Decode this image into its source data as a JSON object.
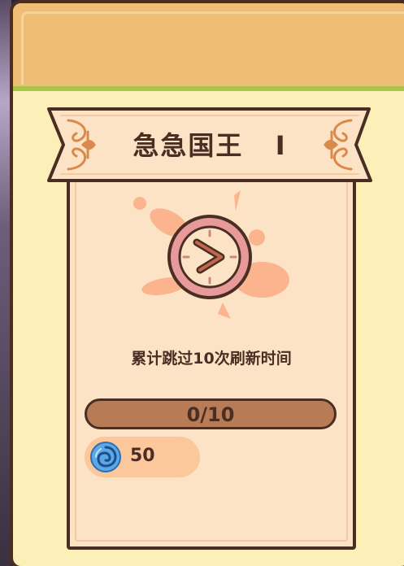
{
  "achievement": {
    "title": "急急国王",
    "level": "I",
    "description": "累计跳过10次刷新时间",
    "progress_text": "0/10",
    "progress_fraction": 0.0
  },
  "reward": {
    "icon": "blue-swirl-gem-icon",
    "amount": "50"
  },
  "colors": {
    "panel_bg": "#fcefb8",
    "header_bg": "#f0bd74",
    "header_accent": "#a9c54a",
    "card_bg": "#fde3c5",
    "outline": "#4a2e24",
    "progress_track": "#b77b55",
    "reward_pill": "#fcc79a",
    "clock_face": "#e89a9a"
  }
}
